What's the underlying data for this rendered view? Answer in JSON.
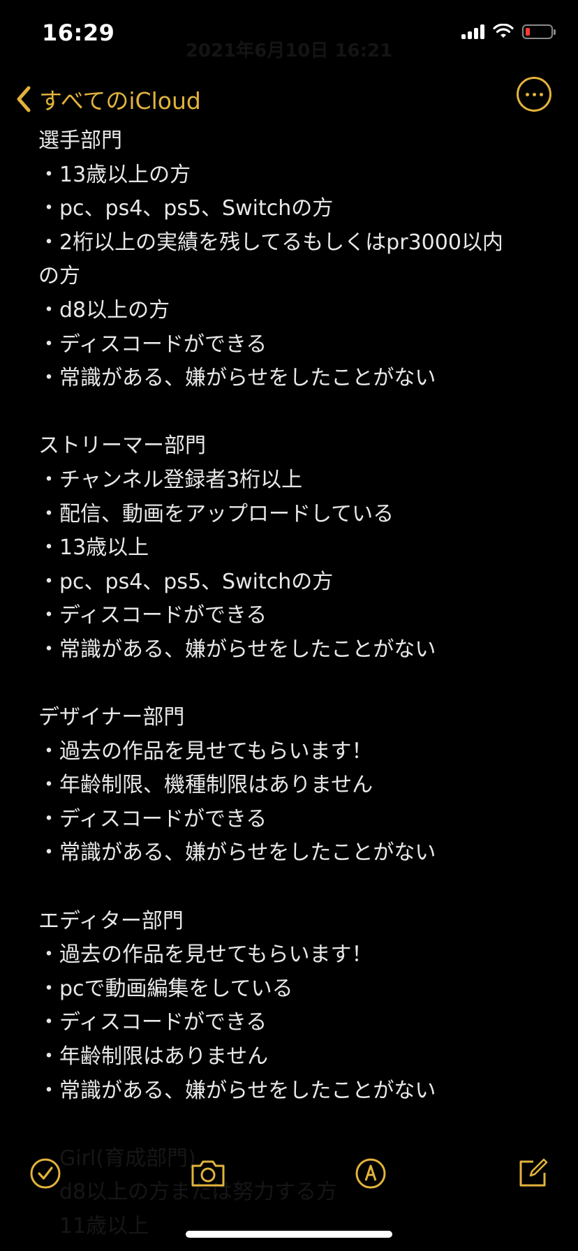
{
  "status_bar": {
    "time": "16:29"
  },
  "header": {
    "faded_date": "2021年6月10日 16:21"
  },
  "nav": {
    "back_label": "すべてのiCloud",
    "accent_color": "#e2b33c"
  },
  "note": {
    "lines": [
      "選手部門",
      "・13歳以上の方",
      "・pc、ps4、ps5、Switchの方",
      "・2桁以上の実績を残してるもしくはpr3000以内",
      "の方",
      "・d8以上の方",
      "・ディスコードができる",
      "・常識がある、嫌がらせをしたことがない",
      "",
      "ストリーマー部門",
      "・チャンネル登録者3桁以上",
      "・配信、動画をアップロードしている",
      "・13歳以上",
      "・pc、ps4、ps5、Switchの方",
      "・ディスコードができる",
      "・常識がある、嫌がらせをしたことがない",
      "",
      "デザイナー部門",
      "・過去の作品を見せてもらいます！",
      "・年齢制限、機種制限はありません",
      "・ディスコードができる",
      "・常識がある、嫌がらせをしたことがない",
      "",
      "エディター部門",
      "・過去の作品を見せてもらいます！",
      "・pcで動画編集をしている",
      "・ディスコードができる",
      "・年齢制限はありません",
      "・常識がある、嫌がらせをしたことがない"
    ],
    "faded_lines": [
      "Girl(育成部門)",
      "d8以上の方または努力する方",
      "11歳以上"
    ]
  },
  "toolbar": {
    "icons": [
      "checklist-icon",
      "camera-icon",
      "markup-icon",
      "compose-icon"
    ]
  }
}
